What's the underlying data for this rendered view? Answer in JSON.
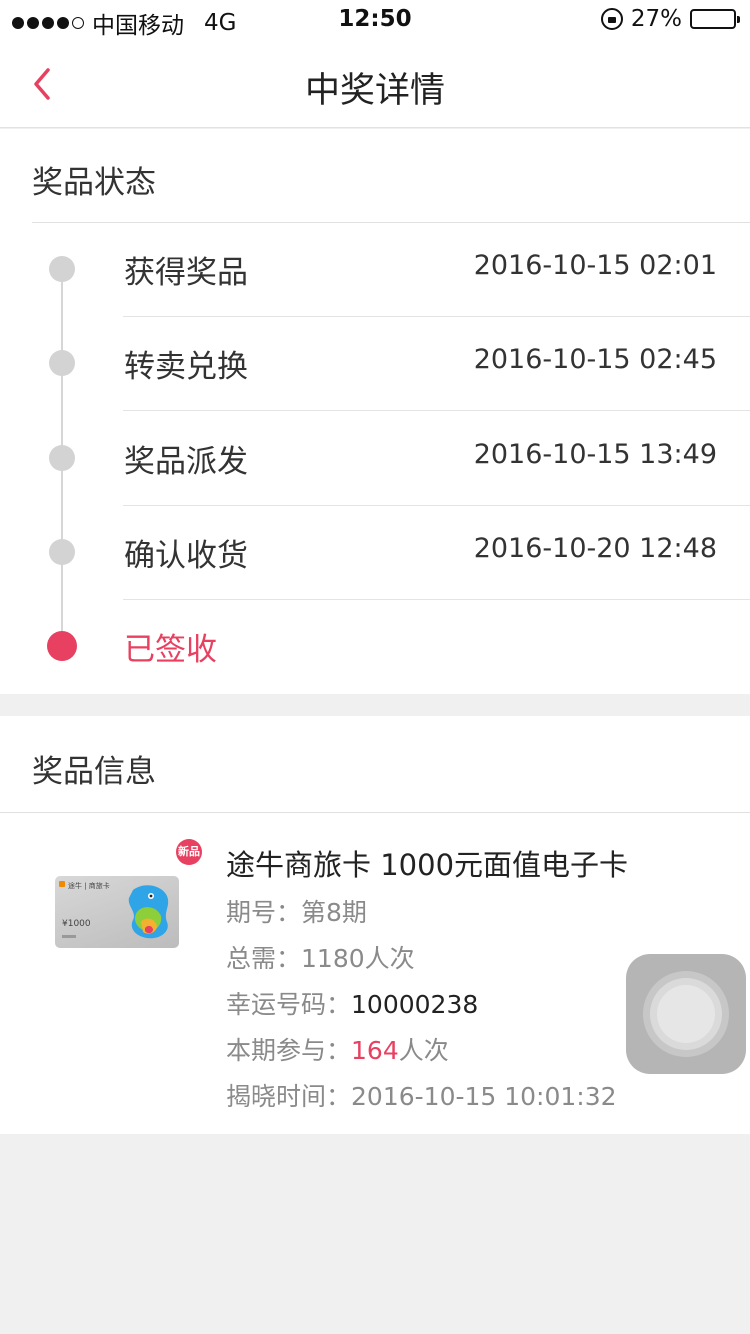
{
  "status_bar": {
    "carrier": "中国移动",
    "network": "4G",
    "time": "12:50",
    "battery": "27%",
    "battery_level": 0.27
  },
  "nav": {
    "title": "中奖详情"
  },
  "status_section": {
    "title": "奖品状态",
    "steps": [
      {
        "label": "获得奖品",
        "time": "2016-10-15 02:01"
      },
      {
        "label": "转卖兑换",
        "time": "2016-10-15 02:45"
      },
      {
        "label": "奖品派发",
        "time": "2016-10-15 13:49"
      },
      {
        "label": "确认收货",
        "time": "2016-10-20 12:48"
      },
      {
        "label": "已签收",
        "time": ""
      }
    ]
  },
  "info_section": {
    "title": "奖品信息",
    "badge": "新品",
    "card": {
      "brand": "途牛 | 商旅卡",
      "value": "¥1000"
    },
    "prize_name": "途牛商旅卡 1000元面值电子卡",
    "period_label": "期号：",
    "period_value": "第8期",
    "total_label": "总需：",
    "total_value": "1180人次",
    "lucky_label": "幸运号码：",
    "lucky_value": "10000238",
    "join_label": "本期参与：",
    "join_count": "164",
    "join_unit": "人次",
    "reveal_label": "揭晓时间：",
    "reveal_value": "2016-10-15 10:01:32"
  },
  "colors": {
    "accent": "#e84060",
    "timeline_dot": "#d3d3d3",
    "background": "#f0f0f0"
  }
}
